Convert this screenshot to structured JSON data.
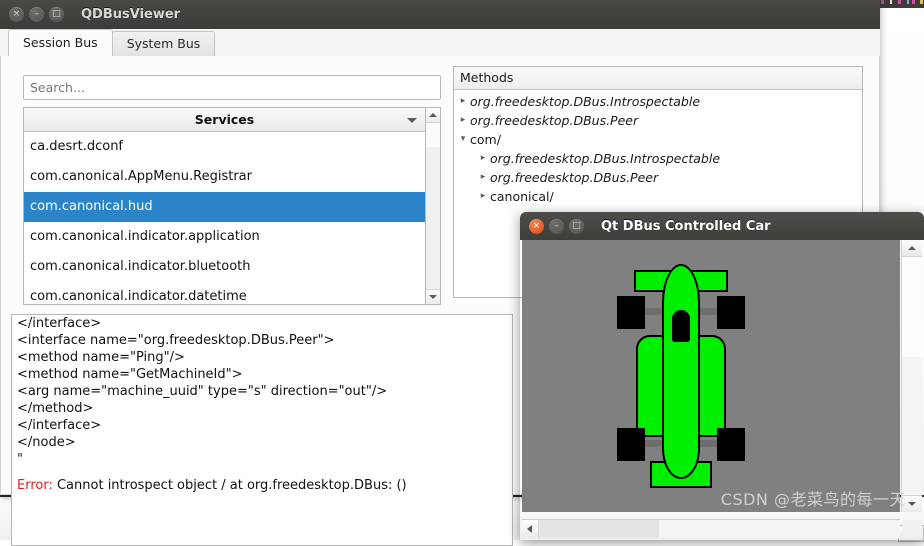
{
  "main_window": {
    "title": "QDBusViewer",
    "controls": {
      "close": "×",
      "minimize": "–",
      "maximize": "□"
    },
    "tabs": [
      {
        "label": "Session Bus",
        "active": true
      },
      {
        "label": "System Bus",
        "active": false
      }
    ],
    "search": {
      "placeholder": "Search...",
      "value": ""
    },
    "services": {
      "header": "Services",
      "items": [
        {
          "name": "ca.desrt.dconf",
          "selected": false
        },
        {
          "name": "com.canonical.AppMenu.Registrar",
          "selected": false
        },
        {
          "name": "com.canonical.hud",
          "selected": true
        },
        {
          "name": "com.canonical.indicator.application",
          "selected": false
        },
        {
          "name": "com.canonical.indicator.bluetooth",
          "selected": false
        },
        {
          "name": "com.canonical.indicator.datetime",
          "selected": false
        }
      ],
      "selection_color": "#2b84c8"
    },
    "methods": {
      "header": "Methods",
      "tree": [
        {
          "label": "org.freedesktop.DBus.Introspectable",
          "expanded": false,
          "italic": true,
          "depth": 0,
          "arrow": "▸"
        },
        {
          "label": "org.freedesktop.DBus.Peer",
          "expanded": false,
          "italic": true,
          "depth": 0,
          "arrow": "▸"
        },
        {
          "label": "com/",
          "expanded": true,
          "italic": false,
          "depth": 0,
          "arrow": "▾"
        },
        {
          "label": "org.freedesktop.DBus.Introspectable",
          "expanded": false,
          "italic": true,
          "depth": 1,
          "arrow": "▸"
        },
        {
          "label": "org.freedesktop.DBus.Peer",
          "expanded": false,
          "italic": true,
          "depth": 1,
          "arrow": "▸"
        },
        {
          "label": "canonical/",
          "expanded": false,
          "italic": false,
          "depth": 1,
          "arrow": "▸"
        }
      ]
    },
    "log": {
      "lines": [
        "</interface>",
        "<interface name=\"org.freedesktop.DBus.Peer\">",
        "<method name=\"Ping\"/>",
        "<method name=\"GetMachineId\">",
        "<arg name=\"machine_uuid\" type=\"s\" direction=\"out\"/>",
        "</method>",
        "</interface>",
        "</node>",
        "\""
      ],
      "error_label": "Error:",
      "error_message": "Cannot introspect object / at org.freedesktop.DBus: ()",
      "error_color": "#e02020"
    }
  },
  "car_window": {
    "title": "Qt DBus Controlled Car",
    "controls": {
      "close": "×",
      "minimize": "–",
      "maximize": "□"
    },
    "canvas_color": "#808080",
    "car_color": "#00ee00",
    "wheel_color": "#000000"
  },
  "watermark": {
    "text": "CSDN @老菜鸟的每一天"
  },
  "background": {
    "code_snippet": "/\n="
  }
}
